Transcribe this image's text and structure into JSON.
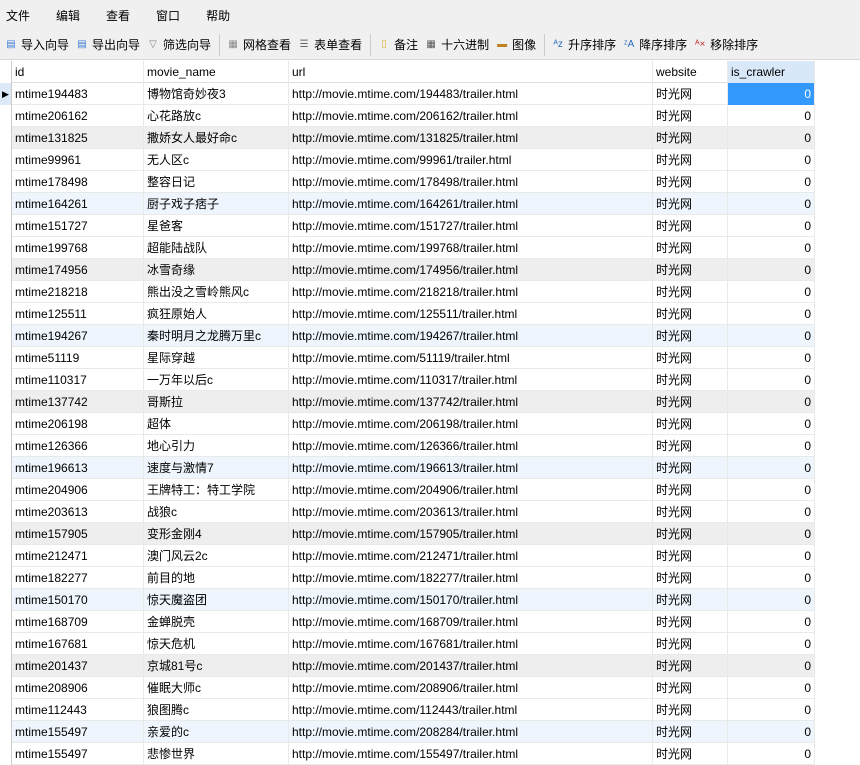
{
  "menu": [
    "文件",
    "编辑",
    "查看",
    "窗口",
    "帮助"
  ],
  "toolbar": [
    {
      "label": "导入向导",
      "icon": "import-icon"
    },
    {
      "label": "导出向导",
      "icon": "export-icon"
    },
    {
      "label": "筛选向导",
      "icon": "filter-icon"
    },
    {
      "label": "网格查看",
      "icon": "grid-icon"
    },
    {
      "label": "表单查看",
      "icon": "form-icon"
    },
    {
      "label": "备注",
      "icon": "memo-icon"
    },
    {
      "label": "十六进制",
      "icon": "hex-icon"
    },
    {
      "label": "图像",
      "icon": "image-icon"
    },
    {
      "label": "升序排序",
      "icon": "sort-asc-icon"
    },
    {
      "label": "降序排序",
      "icon": "sort-desc-icon"
    },
    {
      "label": "移除排序",
      "icon": "remove-sort-icon"
    }
  ],
  "columns": [
    "id",
    "movie_name",
    "url",
    "website",
    "is_crawler"
  ],
  "rows": [
    [
      "mtime194483",
      "博物馆奇妙夜3",
      "http://movie.mtime.com/194483/trailer.html",
      "时光网",
      "0"
    ],
    [
      "mtime206162",
      "心花路放c",
      "http://movie.mtime.com/206162/trailer.html",
      "时光网",
      "0"
    ],
    [
      "mtime131825",
      "撒娇女人最好命c",
      "http://movie.mtime.com/131825/trailer.html",
      "时光网",
      "0"
    ],
    [
      "mtime99961",
      "无人区c",
      "http://movie.mtime.com/99961/trailer.html",
      "时光网",
      "0"
    ],
    [
      "mtime178498",
      "整容日记",
      "http://movie.mtime.com/178498/trailer.html",
      "时光网",
      "0"
    ],
    [
      "mtime164261",
      "厨子戏子痞子",
      "http://movie.mtime.com/164261/trailer.html",
      "时光网",
      "0"
    ],
    [
      "mtime151727",
      "星爸客",
      "http://movie.mtime.com/151727/trailer.html",
      "时光网",
      "0"
    ],
    [
      "mtime199768",
      "超能陆战队",
      "http://movie.mtime.com/199768/trailer.html",
      "时光网",
      "0"
    ],
    [
      "mtime174956",
      "冰雪奇缘",
      "http://movie.mtime.com/174956/trailer.html",
      "时光网",
      "0"
    ],
    [
      "mtime218218",
      "熊出没之雪岭熊风c",
      "http://movie.mtime.com/218218/trailer.html",
      "时光网",
      "0"
    ],
    [
      "mtime125511",
      "疯狂原始人",
      "http://movie.mtime.com/125511/trailer.html",
      "时光网",
      "0"
    ],
    [
      "mtime194267",
      "秦时明月之龙腾万里c",
      "http://movie.mtime.com/194267/trailer.html",
      "时光网",
      "0"
    ],
    [
      "mtime51119",
      "星际穿越",
      "http://movie.mtime.com/51119/trailer.html",
      "时光网",
      "0"
    ],
    [
      "mtime110317",
      "一万年以后c",
      "http://movie.mtime.com/110317/trailer.html",
      "时光网",
      "0"
    ],
    [
      "mtime137742",
      "哥斯拉",
      "http://movie.mtime.com/137742/trailer.html",
      "时光网",
      "0"
    ],
    [
      "mtime206198",
      "超体",
      "http://movie.mtime.com/206198/trailer.html",
      "时光网",
      "0"
    ],
    [
      "mtime126366",
      "地心引力",
      "http://movie.mtime.com/126366/trailer.html",
      "时光网",
      "0"
    ],
    [
      "mtime196613",
      "速度与激情7",
      "http://movie.mtime.com/196613/trailer.html",
      "时光网",
      "0"
    ],
    [
      "mtime204906",
      "王牌特工：特工学院",
      "http://movie.mtime.com/204906/trailer.html",
      "时光网",
      "0"
    ],
    [
      "mtime203613",
      "战狼c",
      "http://movie.mtime.com/203613/trailer.html",
      "时光网",
      "0"
    ],
    [
      "mtime157905",
      "变形金刚4",
      "http://movie.mtime.com/157905/trailer.html",
      "时光网",
      "0"
    ],
    [
      "mtime212471",
      "澳门风云2c",
      "http://movie.mtime.com/212471/trailer.html",
      "时光网",
      "0"
    ],
    [
      "mtime182277",
      "前目的地",
      "http://movie.mtime.com/182277/trailer.html",
      "时光网",
      "0"
    ],
    [
      "mtime150170",
      "惊天魔盗团",
      "http://movie.mtime.com/150170/trailer.html",
      "时光网",
      "0"
    ],
    [
      "mtime168709",
      "金蝉脱壳",
      "http://movie.mtime.com/168709/trailer.html",
      "时光网",
      "0"
    ],
    [
      "mtime167681",
      "惊天危机",
      "http://movie.mtime.com/167681/trailer.html",
      "时光网",
      "0"
    ],
    [
      "mtime201437",
      "京城81号c",
      "http://movie.mtime.com/201437/trailer.html",
      "时光网",
      "0"
    ],
    [
      "mtime208906",
      "催眠大师c",
      "http://movie.mtime.com/208906/trailer.html",
      "时光网",
      "0"
    ],
    [
      "mtime112443",
      "狼图腾c",
      "http://movie.mtime.com/112443/trailer.html",
      "时光网",
      "0"
    ],
    [
      "mtime155497",
      "亲爱的c",
      "http://movie.mtime.com/208284/trailer.html",
      "时光网",
      "0"
    ],
    [
      "mtime155497",
      "悲惨世界",
      "http://movie.mtime.com/155497/trailer.html",
      "时光网",
      "0"
    ]
  ],
  "colors": {
    "selected": "#3399ff",
    "stripe_gray": "#eeeeee",
    "stripe_blue": "#eef5fd"
  }
}
